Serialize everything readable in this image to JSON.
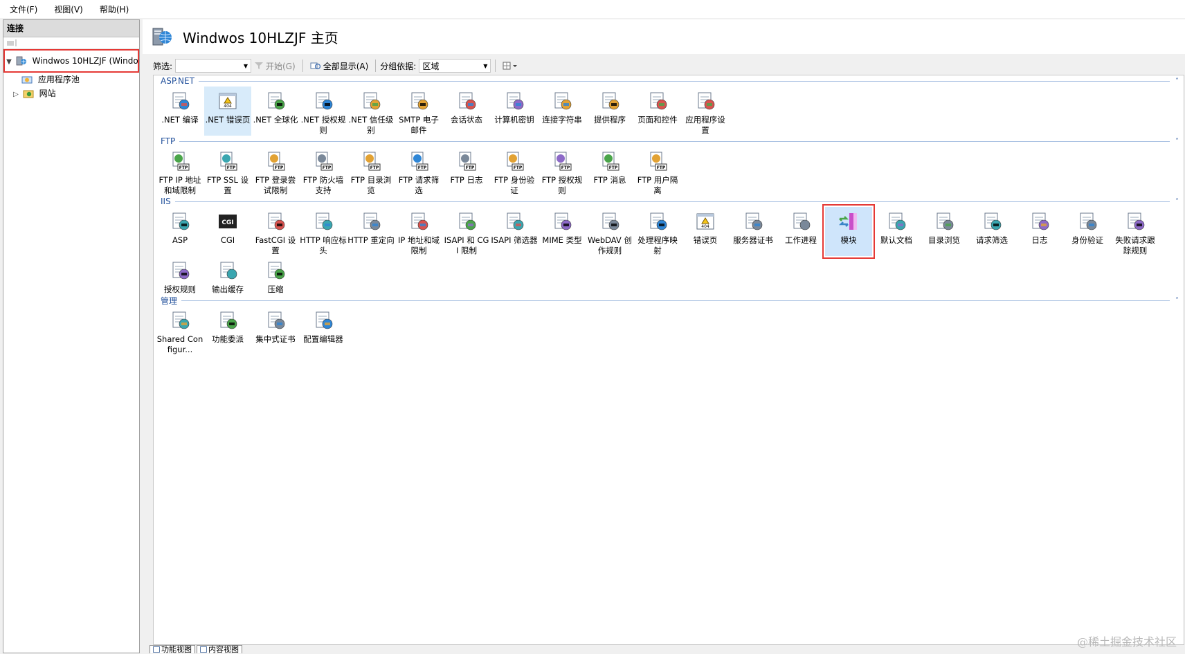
{
  "menu": [
    "文件(F)",
    "视图(V)",
    "帮助(H)"
  ],
  "connections": {
    "header": "连接",
    "root_label": "Windwos 10HLZJF (Windo",
    "children": [
      "应用程序池",
      "网站"
    ]
  },
  "page": {
    "title": "Windwos 10HLZJF 主页"
  },
  "filter": {
    "label": "筛选:",
    "value": "",
    "go_label": "开始(G)",
    "showall_label": "全部显示(A)",
    "groupby_label": "分组依据:",
    "groupby_value": "区域"
  },
  "groups": [
    {
      "name": "ASP.NET",
      "items": [
        {
          "label": ".NET 编译",
          "icon": "compile-icon"
        },
        {
          "label": ".NET 错误页",
          "icon": "error-page-icon"
        },
        {
          "label": ".NET 全球化",
          "icon": "globe-icon"
        },
        {
          "label": ".NET 授权规则",
          "icon": "lock-doc-icon"
        },
        {
          "label": ".NET 信任级别",
          "icon": "trust-globe-icon"
        },
        {
          "label": "SMTP 电子邮件",
          "icon": "mail-icon"
        },
        {
          "label": "会话状态",
          "icon": "session-icon"
        },
        {
          "label": "计算机密钥",
          "icon": "machinekey-icon"
        },
        {
          "label": "连接字符串",
          "icon": "connstring-icon"
        },
        {
          "label": "提供程序",
          "icon": "provider-icon"
        },
        {
          "label": "页面和控件",
          "icon": "pages-icon"
        },
        {
          "label": "应用程序设置",
          "icon": "appsettings-icon"
        }
      ]
    },
    {
      "name": "FTP",
      "items": [
        {
          "label": "FTP IP 地址和域限制",
          "icon": "ftp-ip-icon"
        },
        {
          "label": "FTP SSL 设置",
          "icon": "ftp-ssl-icon"
        },
        {
          "label": "FTP 登录尝试限制",
          "icon": "ftp-logon-icon"
        },
        {
          "label": "FTP 防火墙支持",
          "icon": "ftp-firewall-icon"
        },
        {
          "label": "FTP 目录浏览",
          "icon": "ftp-dir-icon"
        },
        {
          "label": "FTP 请求筛选",
          "icon": "ftp-filter-icon"
        },
        {
          "label": "FTP 日志",
          "icon": "ftp-log-icon"
        },
        {
          "label": "FTP 身份验证",
          "icon": "ftp-auth-icon"
        },
        {
          "label": "FTP 授权规则",
          "icon": "ftp-authz-icon"
        },
        {
          "label": "FTP 消息",
          "icon": "ftp-msg-icon"
        },
        {
          "label": "FTP 用户隔离",
          "icon": "ftp-iso-icon"
        }
      ]
    },
    {
      "name": "IIS",
      "items": [
        {
          "label": "ASP",
          "icon": "asp-icon"
        },
        {
          "label": "CGI",
          "icon": "cgi-icon"
        },
        {
          "label": "FastCGI 设置",
          "icon": "fastcgi-icon"
        },
        {
          "label": "HTTP 响应标头",
          "icon": "http-headers-icon"
        },
        {
          "label": "HTTP 重定向",
          "icon": "redirect-icon"
        },
        {
          "label": "IP 地址和域限制",
          "icon": "ip-restrict-icon"
        },
        {
          "label": "ISAPI 和 CGI 限制",
          "icon": "isapi-cgi-icon"
        },
        {
          "label": "ISAPI 筛选器",
          "icon": "isapi-filter-icon"
        },
        {
          "label": "MIME 类型",
          "icon": "mime-icon"
        },
        {
          "label": "WebDAV 创作规则",
          "icon": "webdav-icon"
        },
        {
          "label": "处理程序映射",
          "icon": "handler-icon"
        },
        {
          "label": "错误页",
          "icon": "error-page-icon"
        },
        {
          "label": "服务器证书",
          "icon": "cert-icon"
        },
        {
          "label": "工作进程",
          "icon": "worker-icon"
        },
        {
          "label": "模块",
          "icon": "modules-icon",
          "highlighted": true
        },
        {
          "label": "默认文档",
          "icon": "default-doc-icon"
        },
        {
          "label": "目录浏览",
          "icon": "dir-browse-icon"
        },
        {
          "label": "请求筛选",
          "icon": "req-filter-icon"
        },
        {
          "label": "日志",
          "icon": "log-icon"
        },
        {
          "label": "身份验证",
          "icon": "auth-icon"
        },
        {
          "label": "失败请求跟踪规则",
          "icon": "failed-req-icon"
        },
        {
          "label": "授权规则",
          "icon": "authz-icon"
        },
        {
          "label": "输出缓存",
          "icon": "output-cache-icon"
        },
        {
          "label": "压缩",
          "icon": "compression-icon"
        }
      ]
    },
    {
      "name": "管理",
      "items": [
        {
          "label": "Shared Configur...",
          "icon": "shared-config-icon"
        },
        {
          "label": "功能委派",
          "icon": "delegation-icon"
        },
        {
          "label": "集中式证书",
          "icon": "central-cert-icon"
        },
        {
          "label": "配置编辑器",
          "icon": "config-editor-icon"
        }
      ]
    }
  ],
  "status_tabs": [
    "功能视图",
    "内容视图"
  ],
  "watermark": "@稀土掘金技术社区",
  "colors": {
    "highlight_box": "#e53935",
    "group_header": "#1f4e9a",
    "selection": "#d8ebfa"
  }
}
